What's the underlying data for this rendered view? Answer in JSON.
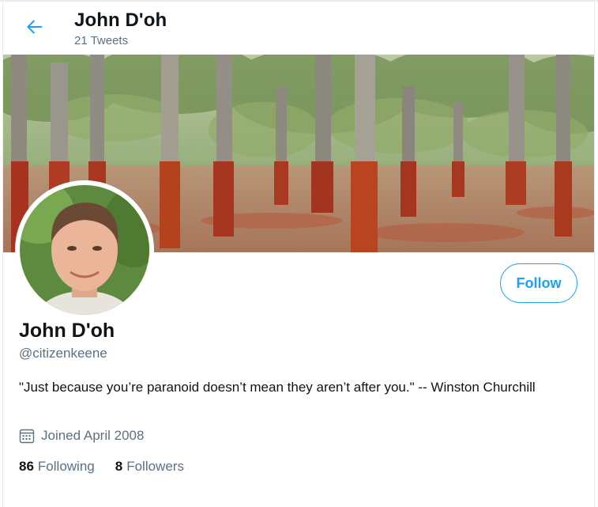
{
  "header": {
    "back_icon": "arrow-left-icon",
    "name": "John D'oh",
    "tweet_count": "21 Tweets"
  },
  "banner": {
    "description_icon": "forest-photo"
  },
  "avatar": {
    "icon": "profile-photo"
  },
  "follow_label": "Follow",
  "profile": {
    "name": "John D'oh",
    "handle": "@citizenkeene",
    "bio": "\"Just because you’re paranoid doesn’t mean they aren’t after you.\" -- Winston Churchill",
    "joined_icon": "calendar-icon",
    "joined": "Joined April 2008"
  },
  "stats": {
    "following_count": "86",
    "following_label": "Following",
    "followers_count": "8",
    "followers_label": "Followers"
  },
  "colors": {
    "accent": "#1da1f2",
    "secondary_text": "#5b7083",
    "primary_text": "#0f1419"
  }
}
